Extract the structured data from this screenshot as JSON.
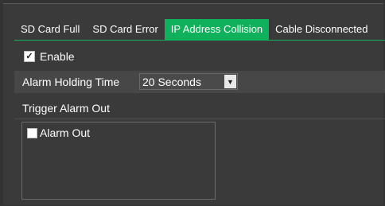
{
  "tabs": [
    {
      "label": "SD Card Full",
      "active": false
    },
    {
      "label": "SD Card Error",
      "active": false
    },
    {
      "label": "IP Address Collision",
      "active": true
    },
    {
      "label": "Cable Disconnected",
      "active": false
    }
  ],
  "enable": {
    "label": "Enable",
    "checked": true
  },
  "alarm_holding": {
    "label": "Alarm Holding Time",
    "value": "20 Seconds"
  },
  "trigger": {
    "label": "Trigger Alarm Out",
    "items": [
      {
        "label": "Alarm Out",
        "checked": false
      }
    ]
  },
  "colors": {
    "accent": "#10b15c",
    "background": "#333333"
  }
}
